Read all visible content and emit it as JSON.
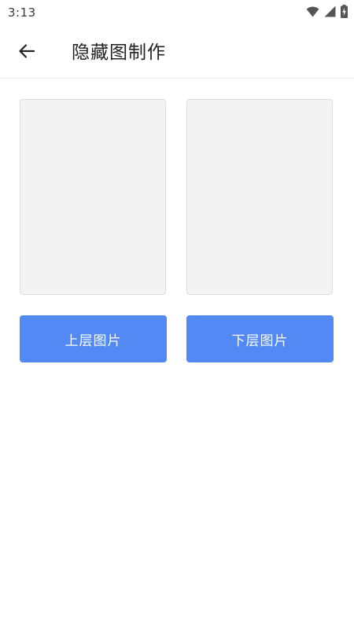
{
  "status_bar": {
    "time": "3:13",
    "icons": [
      "wifi-icon",
      "signal-icon",
      "battery-charging-icon"
    ]
  },
  "app_bar": {
    "back_icon": "arrow-left-icon",
    "title": "隐藏图制作"
  },
  "main": {
    "top_button_label": "上层图片",
    "bottom_button_label": "下层图片"
  },
  "colors": {
    "accent": "#5289f5",
    "slot_background": "#f3f3f3",
    "slot_border": "#dcdcdc"
  }
}
